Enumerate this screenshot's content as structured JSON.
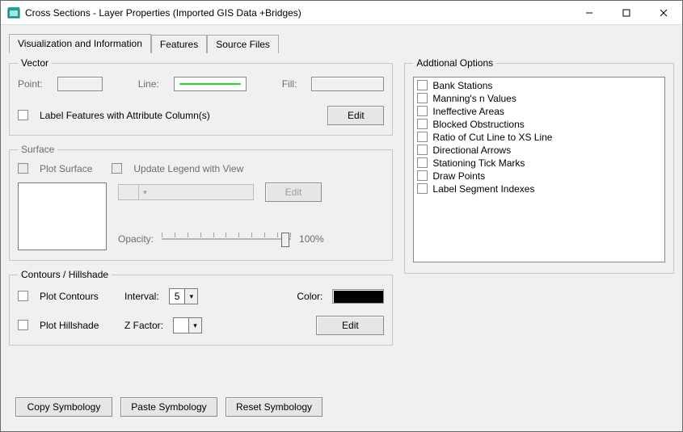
{
  "window": {
    "title": "Cross Sections - Layer Properties (Imported GIS Data +Bridges)"
  },
  "tabs": {
    "t0": "Visualization and Information",
    "t1": "Features",
    "t2": "Source Files"
  },
  "vector": {
    "legend": "Vector",
    "point_label": "Point:",
    "line_label": "Line:",
    "fill_label": "Fill:",
    "label_features": "Label Features with Attribute Column(s)",
    "edit_label": "Edit",
    "line_color": "#2bd82b"
  },
  "surface": {
    "legend": "Surface",
    "plot_surface": "Plot Surface",
    "update_legend": "Update Legend with View",
    "edit_label": "Edit",
    "opacity_label": "Opacity:",
    "opacity_value": "100%"
  },
  "contours": {
    "legend": "Contours / Hillshade",
    "plot_contours": "Plot Contours",
    "plot_hillshade": "Plot Hillshade",
    "interval_label": "Interval:",
    "interval_value": "5",
    "zfactor_label": "Z Factor:",
    "zfactor_value": "",
    "color_label": "Color:",
    "color_value": "#000000",
    "edit_label": "Edit"
  },
  "additional": {
    "legend": "Addtional Options",
    "items": [
      "Bank Stations",
      "Manning's n Values",
      "Ineffective Areas",
      "Blocked Obstructions",
      "Ratio of Cut Line to XS Line",
      "Directional Arrows",
      "Stationing Tick Marks",
      "Draw Points",
      "Label Segment Indexes"
    ]
  },
  "buttons": {
    "copy": "Copy Symbology",
    "paste": "Paste Symbology",
    "reset": "Reset Symbology"
  }
}
